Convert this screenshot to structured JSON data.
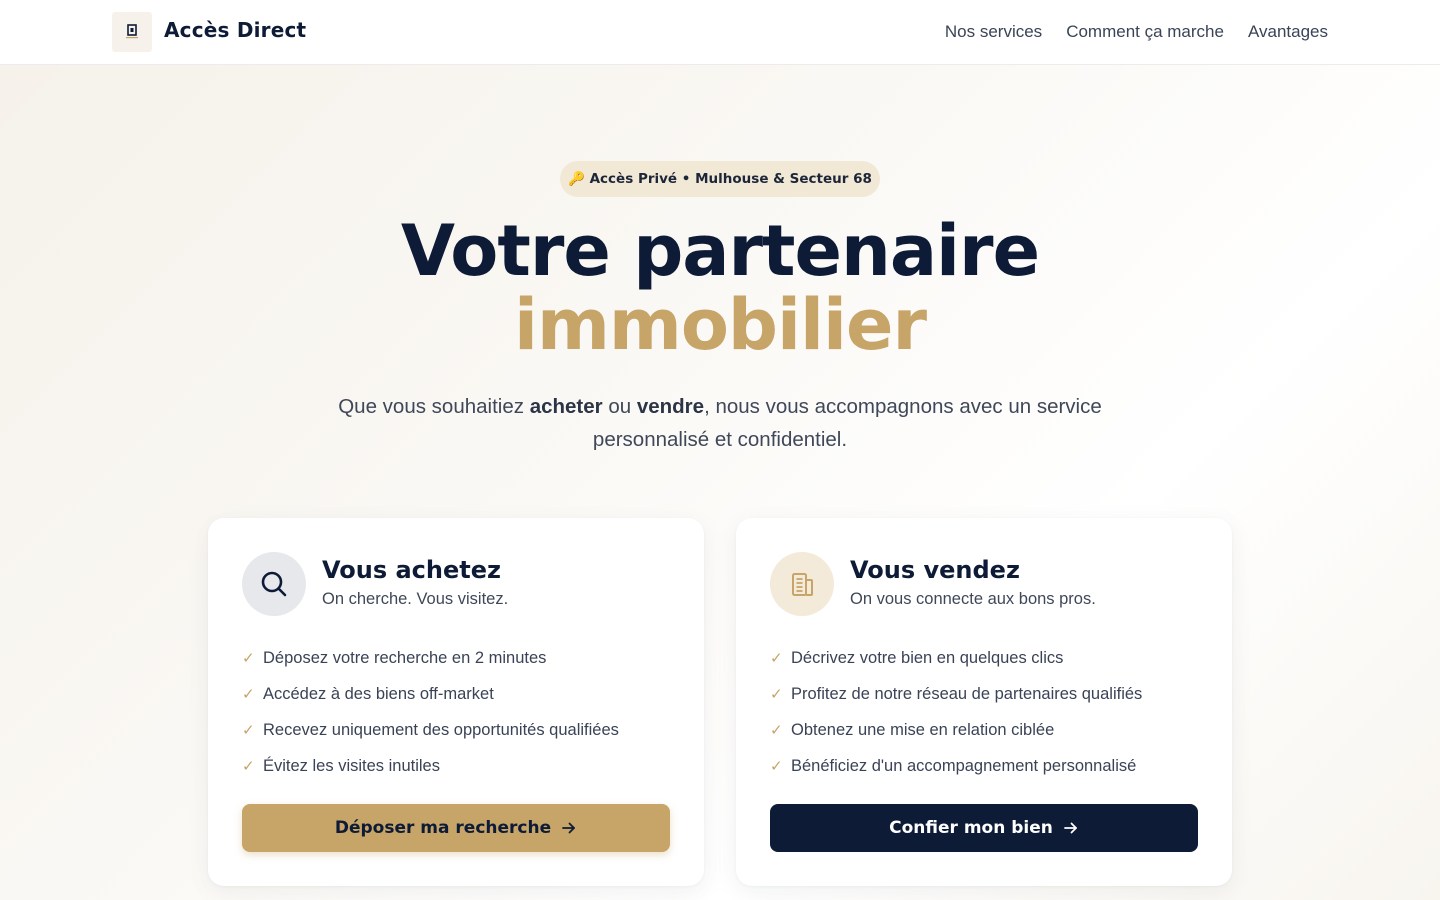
{
  "header": {
    "brand": "Accès Direct",
    "nav": [
      "Nos services",
      "Comment ça marche",
      "Avantages"
    ]
  },
  "hero": {
    "badge": "🔑 Accès Privé • Mulhouse & Secteur 68",
    "title_line1": "Votre partenaire",
    "title_line2": "immobilier",
    "subtitle_pre": "Que vous souhaitiez ",
    "subtitle_bold1": "acheter",
    "subtitle_mid": " ou ",
    "subtitle_bold2": "vendre",
    "subtitle_post": ", nous vous accompagnons avec un service personnalisé et confidentiel."
  },
  "buy_card": {
    "title": "Vous achetez",
    "subtitle": "On cherche. Vous visitez.",
    "items": [
      "Déposez votre recherche en 2 minutes",
      "Accédez à des biens off-market",
      "Recevez uniquement des opportunités qualifiées",
      "Évitez les visites inutiles"
    ],
    "button": "Déposer ma recherche",
    "icon": "search-icon"
  },
  "sell_card": {
    "title": "Vous vendez",
    "subtitle": "On vous connecte aux bons pros.",
    "items": [
      "Décrivez votre bien en quelques clics",
      "Profitez de notre réseau de partenaires qualifiés",
      "Obtenez une mise en relation ciblée",
      "Bénéficiez d'un accompagnement personnalisé"
    ],
    "button": "Confier mon bien",
    "icon": "building-icon"
  },
  "check_mark": "✓",
  "colors": {
    "navy": "#0e1b36",
    "gold": "#c7a468",
    "badge_bg": "#f1e8d6"
  }
}
